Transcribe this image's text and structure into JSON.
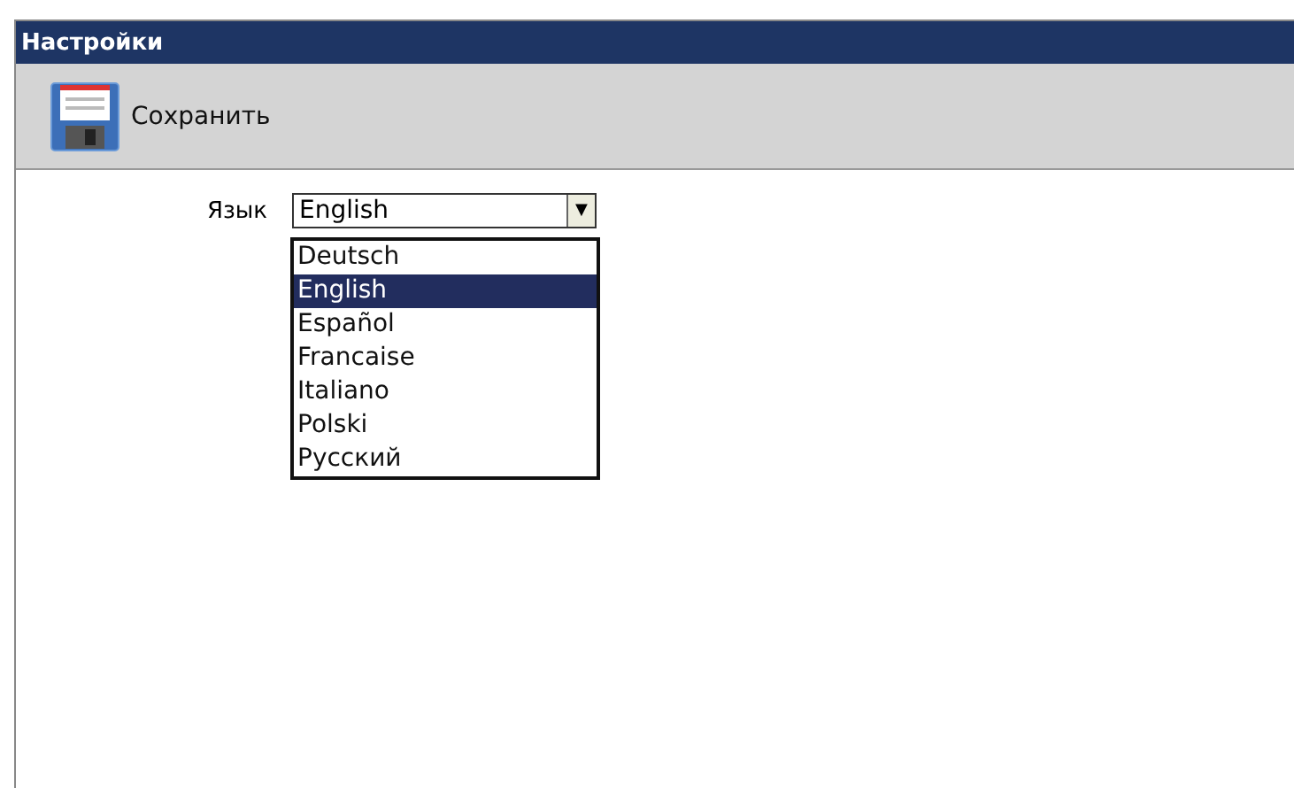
{
  "window": {
    "title": "Настройки"
  },
  "toolbar": {
    "save_button": "Сохранить"
  },
  "language": {
    "label": "Язык",
    "value": "English",
    "dropdown_arrow": "▼",
    "options": [
      {
        "label": "Deutsch",
        "selected": false
      },
      {
        "label": "English",
        "selected": true
      },
      {
        "label": "Español",
        "selected": false
      },
      {
        "label": "Francaise",
        "selected": false
      },
      {
        "label": "Italiano",
        "selected": false
      },
      {
        "label": "Polski",
        "selected": false
      },
      {
        "label": "Русский",
        "selected": false
      }
    ]
  }
}
